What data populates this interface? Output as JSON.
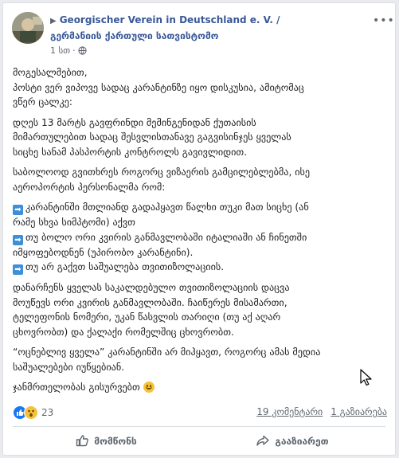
{
  "header": {
    "page_name": "Georgischer Verein in Deutschland e. V. /",
    "group_name": "გერმანიის ქართული სათვისტომო",
    "time": "1 სთ",
    "privacy_icon": "globe-icon",
    "more_icon": "ellipsis-icon"
  },
  "post": {
    "lines": [
      [
        "მოგესალმებით,",
        "პოსტი ვერ ვიპოვე სადაც კარანტინზე იყო დისკუსია, ამიტომაც",
        "ვწერ ცალკე:"
      ],
      [
        "დღეს 13 მარტს გავფრინდი მემინგენიდან ქუთაისის",
        "მიმართულებით სადაც შესვლისთანავე გაგვისინჯეს ყველას",
        "სიცხე სანამ პასპორტის კონტროლს გავივლიდით."
      ],
      [
        "საბოლოოდ გვითხრეს როგორც ვიზაერის გამცილებლებმა, ისე",
        "აეროპორტის პერსონალმა რომ:"
      ],
      [
        "[A] კარანტინში მთლიანდ გადაჰყავთ წალხი თუკი მათ სიცხე (ან",
        "რამე სხვა სიმპტომი) აქვთ",
        "[A] თუ ბოლო ორი კვირის განმავლობაში იტალიაში ან ჩინეთში",
        "იმყოფებოდნენ (უპირობო კარანტინი).",
        "[A] თუ არ გაქვთ საშუალება თვითიზოლაციის."
      ],
      [
        "დანარჩენს ყველას საკალდებულო თვითიზოლაციის დაცვა",
        "მოუწევს ორი კვირის განმავლობაში. ჩაიწერეს მისამართი,",
        "ტელეფონის ნომერი, უკან წასვლის თარიღი (თუ აქ აღარ",
        "ცხოვრობთ) და ქალაქი რომელშიც ცხოვრობთ."
      ],
      [
        "“ოცნებლივ ყველა” კარანტინში არ მიჰყავთ, როგორც ამას მედია",
        "საშუალებები იუწყებიან."
      ],
      [
        "ჯანმრთელობას გისურვებთ [S]"
      ]
    ],
    "arrow_emoji_icon": "right-arrow-emoji-icon",
    "smile_emoji_icon": "smile-emoji-icon"
  },
  "stats": {
    "reaction_count": "23",
    "comments": "19 კომენტარი",
    "shares": "1 გაზიარება",
    "reaction_icons": [
      "like-reaction-icon",
      "wow-reaction-icon"
    ]
  },
  "actions": {
    "like_label": "მომწონს",
    "share_label": "გააზიარეთ"
  },
  "colors": {
    "link": "#385898",
    "meta": "#616770",
    "like_blue": "#1877f2",
    "background": "#e9ebee"
  }
}
